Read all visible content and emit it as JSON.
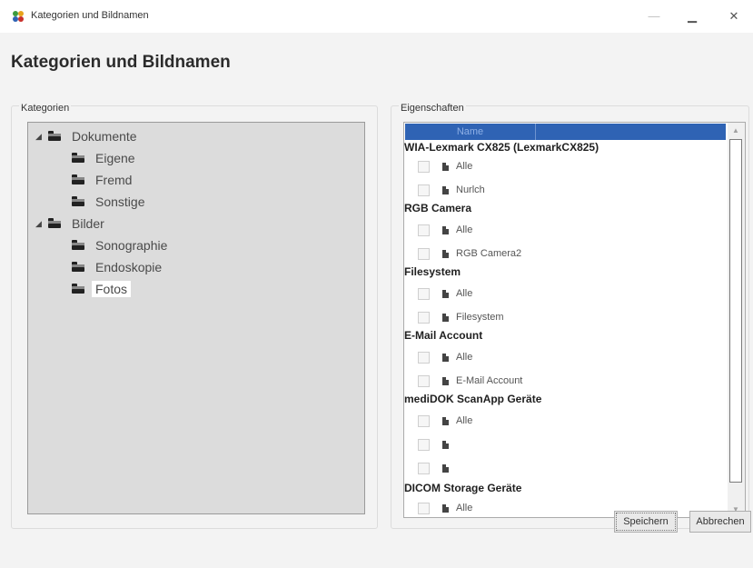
{
  "window": {
    "title": "Kategorien und Bildnamen",
    "min_glyph": "—",
    "max_glyph": "▁",
    "close_glyph": "✕"
  },
  "page": {
    "title": "Kategorien und Bildnamen"
  },
  "categories_group": {
    "label": "Kategorien",
    "tree": [
      {
        "label": "Dokumente",
        "expanded": true,
        "level": 0,
        "expander": "◢",
        "icon": "folder-icon"
      },
      {
        "label": "Eigene",
        "level": 1,
        "icon": "folder-icon"
      },
      {
        "label": "Fremd",
        "level": 1,
        "icon": "folder-icon"
      },
      {
        "label": "Sonstige",
        "level": 1,
        "icon": "folder-icon"
      },
      {
        "label": "Bilder",
        "expanded": true,
        "level": 0,
        "expander": "◢",
        "icon": "folder-icon"
      },
      {
        "label": "Sonographie",
        "level": 1,
        "icon": "folder-icon"
      },
      {
        "label": "Endoskopie",
        "level": 1,
        "icon": "folder-icon"
      },
      {
        "label": "Fotos",
        "level": 1,
        "selected": true,
        "icon": "folder-icon"
      }
    ]
  },
  "properties_group": {
    "label": "Eigenschaften",
    "grid_header": {
      "name_column": "Name"
    },
    "sections": [
      {
        "title": "WIA-Lexmark CX825 (LexmarkCX825)",
        "items": [
          "Alle",
          "Nurlch"
        ]
      },
      {
        "title": "RGB Camera",
        "items": [
          "Alle",
          "RGB Camera2"
        ]
      },
      {
        "title": "Filesystem",
        "items": [
          "Alle",
          "Filesystem"
        ]
      },
      {
        "title": "E-Mail Account",
        "items": [
          "Alle",
          "E-Mail Account"
        ]
      },
      {
        "title": "mediDOK ScanApp Geräte",
        "items": [
          "Alle",
          "",
          ""
        ]
      },
      {
        "title": "DICOM Storage Geräte",
        "items": [
          "Alle"
        ]
      }
    ],
    "scroll_up_glyph": "▲",
    "scroll_down_glyph": "▼"
  },
  "buttons": {
    "save": "Speichern",
    "cancel": "Abbrechen"
  },
  "colors": {
    "header_blue": "#2f63b4",
    "tree_background": "#dcdcdc",
    "window_background": "#f3f3f3"
  }
}
